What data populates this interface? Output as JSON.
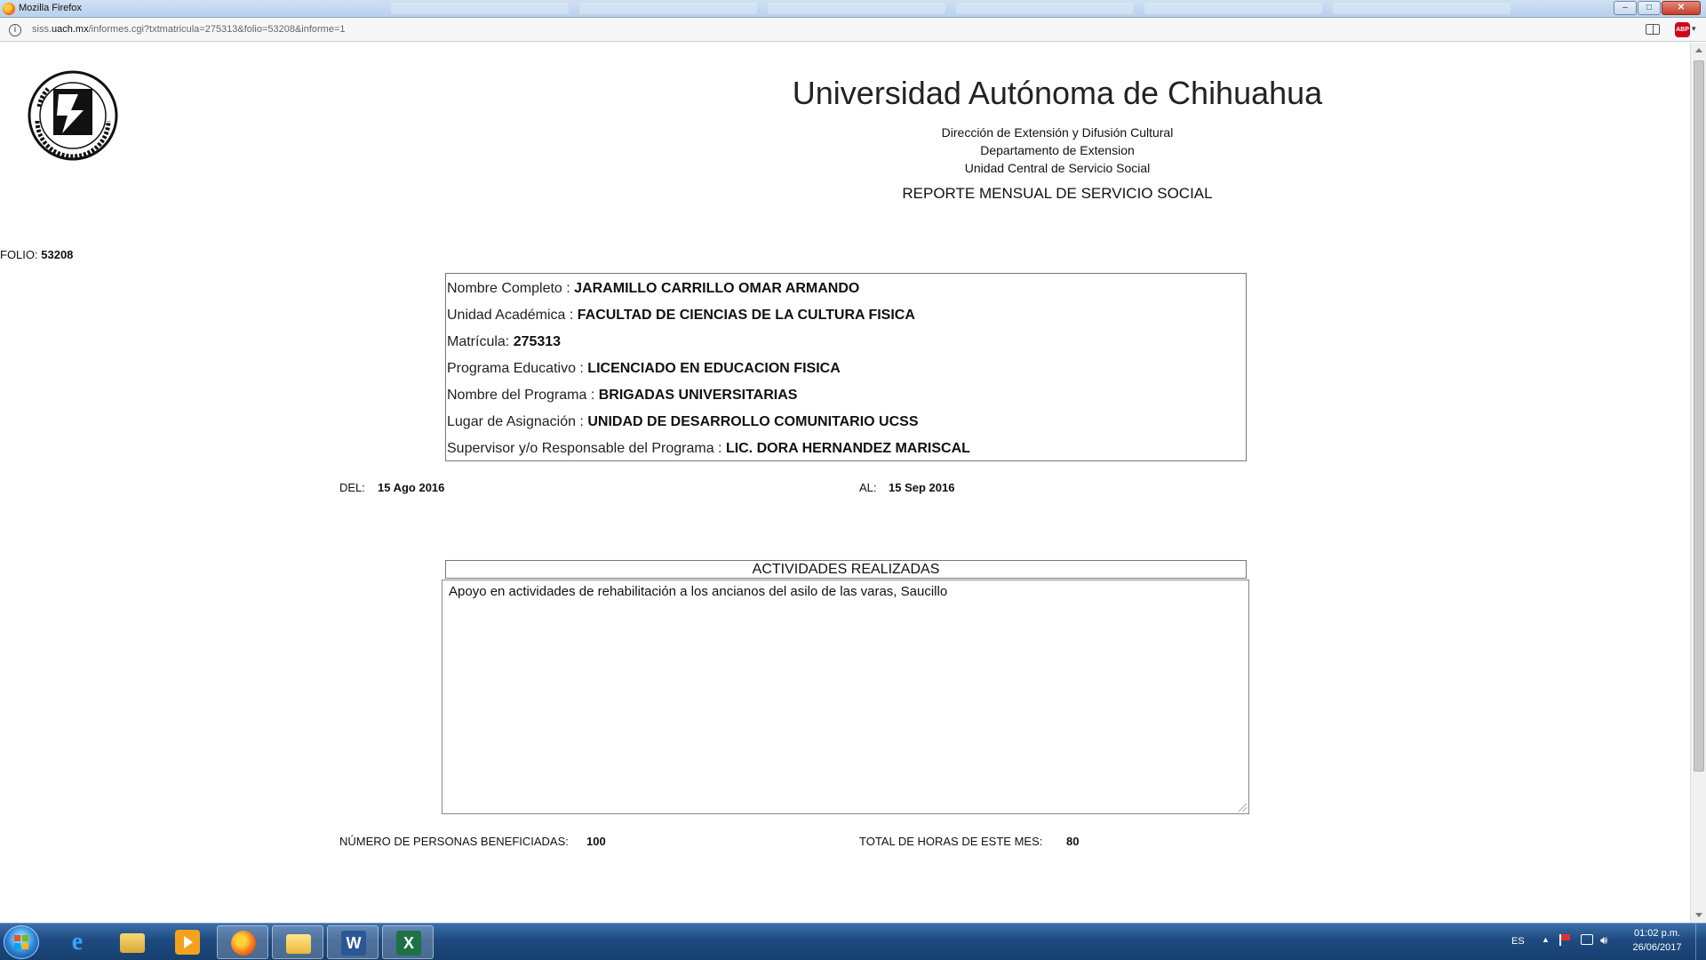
{
  "window": {
    "title": "Mozilla Firefox",
    "controls": {
      "minimize": "–",
      "maximize": "□",
      "close": "✕"
    }
  },
  "urlbar": {
    "url_prefix": "siss.",
    "url_domain": "uach.mx",
    "url_path": "/informes.cgi?txtmatricula=275313&folio=53208&informe=1",
    "info_icon": "i",
    "addon_label": "ABP"
  },
  "header": {
    "university": "Universidad Autónoma de Chihuahua",
    "line1": "Dirección de Extensión y Difusión Cultural",
    "line2": "Departamento de Extension",
    "line3": "Unidad Central de Servicio Social",
    "report_title": "REPORTE MENSUAL DE SERVICIO SOCIAL"
  },
  "folio": {
    "label": "FOLIO:",
    "value": "53208"
  },
  "student": {
    "rows": [
      {
        "label": "Nombre Completo : ",
        "value": "JARAMILLO CARRILLO OMAR ARMANDO"
      },
      {
        "label": "Unidad Académica : ",
        "value": "FACULTAD DE CIENCIAS DE LA CULTURA FISICA"
      },
      {
        "label": "Matrícula: ",
        "value": "275313"
      },
      {
        "label": "Programa Educativo : ",
        "value": "LICENCIADO EN EDUCACION FISICA"
      },
      {
        "label": "Nombre del Programa : ",
        "value": "BRIGADAS UNIVERSITARIAS"
      },
      {
        "label": "Lugar de Asignación : ",
        "value": "UNIDAD DE DESARROLLO COMUNITARIO UCSS"
      },
      {
        "label": "Supervisor y/o Responsable del Programa : ",
        "value": "LIC. DORA HERNANDEZ MARISCAL"
      }
    ]
  },
  "period": {
    "del_label": "DEL:",
    "del_value": "15 Ago 2016",
    "al_label": "AL:",
    "al_value": "15 Sep 2016"
  },
  "activities": {
    "header": "ACTIVIDADES REALIZADAS",
    "text": "Apoyo en actividades de rehabilitación a los ancianos del asilo de las varas, Saucillo"
  },
  "summary": {
    "beneficiaries_label": "NÚMERO DE PERSONAS BENEFICIADAS:",
    "beneficiaries_value": "100",
    "hours_label": "TOTAL DE HORAS DE ESTE MES:",
    "hours_value": "80"
  },
  "taskbar": {
    "ie_glyph": "e",
    "word_glyph": "W",
    "excel_glyph": "X",
    "language": "ES",
    "time": "01:02 p.m.",
    "date": "26/06/2017"
  }
}
